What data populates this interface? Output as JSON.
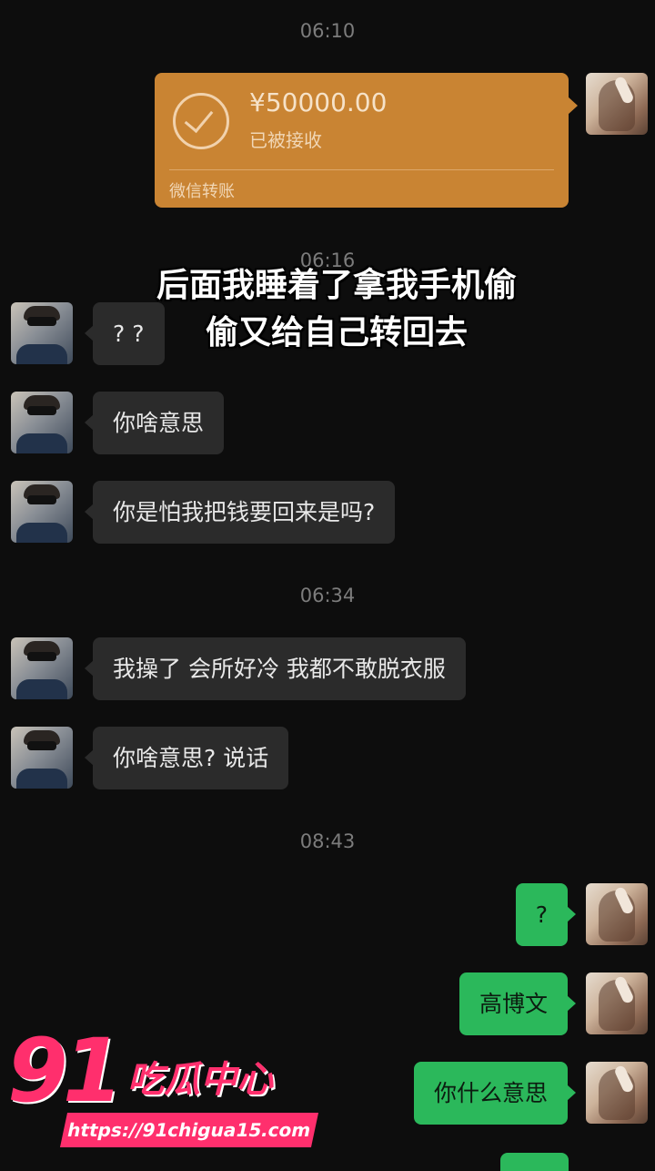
{
  "times": [
    "06:10",
    "06:16",
    "06:34",
    "08:43"
  ],
  "transfer": {
    "amount": "¥50000.00",
    "status": "已被接收",
    "label": "微信转账"
  },
  "caption": {
    "line1": "后面我睡着了拿我手机偷",
    "line2": "偷又给自己转回去"
  },
  "messages": [
    {
      "side": "left",
      "text": "? ?"
    },
    {
      "side": "left",
      "text": "你啥意思"
    },
    {
      "side": "left",
      "text": "你是怕我把钱要回来是吗?"
    },
    {
      "side": "left",
      "text": "我操了 会所好冷 我都不敢脱衣服"
    },
    {
      "side": "left",
      "text": "你啥意思? 说话"
    },
    {
      "side": "right",
      "text": "?"
    },
    {
      "side": "right",
      "text": "高博文"
    },
    {
      "side": "right",
      "text": "你什么意思"
    }
  ],
  "watermark": {
    "number": "91",
    "name": "吃瓜中心",
    "url": "https://91chigua15.com"
  },
  "colors": {
    "background": "#0d0d0d",
    "incoming_bubble": "#2b2b2b",
    "outgoing_bubble": "#2bb85b",
    "transfer_card": "#c98433",
    "watermark": "#ff2f6d"
  }
}
